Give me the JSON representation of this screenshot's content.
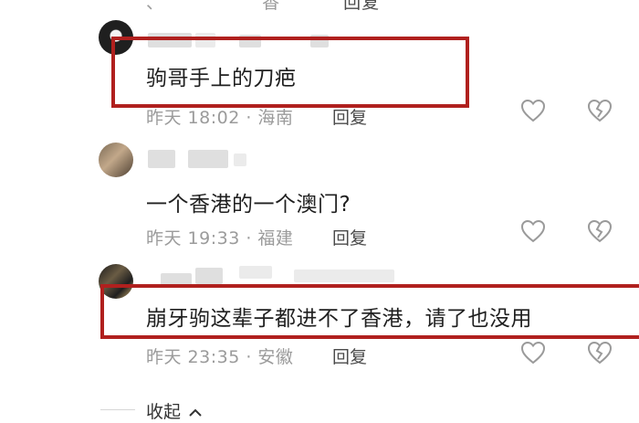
{
  "top_cut": {
    "time_fragment": "、",
    "place_fragment": "香",
    "reply_fragment": "回复"
  },
  "comments": [
    {
      "text": "驹哥手上的刀疤",
      "time": "昨天 18:02",
      "location": "海南",
      "reply_label": "回复"
    },
    {
      "text": "一个香港的一个澳门?",
      "time": "昨天 19:33",
      "location": "福建",
      "reply_label": "回复"
    },
    {
      "text": "崩牙驹这辈子都进不了香港，请了也没用",
      "time": "昨天 23:35",
      "location": "安徽",
      "reply_label": "回复"
    }
  ],
  "separator": " · ",
  "collapse_label": "收起",
  "colors": {
    "highlight_box": "#b0201e",
    "meta_text": "#9b9b9b",
    "heart_icon": "#9a9a9a"
  },
  "icons": {
    "like": "heart-outline-icon",
    "dislike": "broken-heart-icon",
    "collapse_arrow": "chevron-up-icon"
  }
}
